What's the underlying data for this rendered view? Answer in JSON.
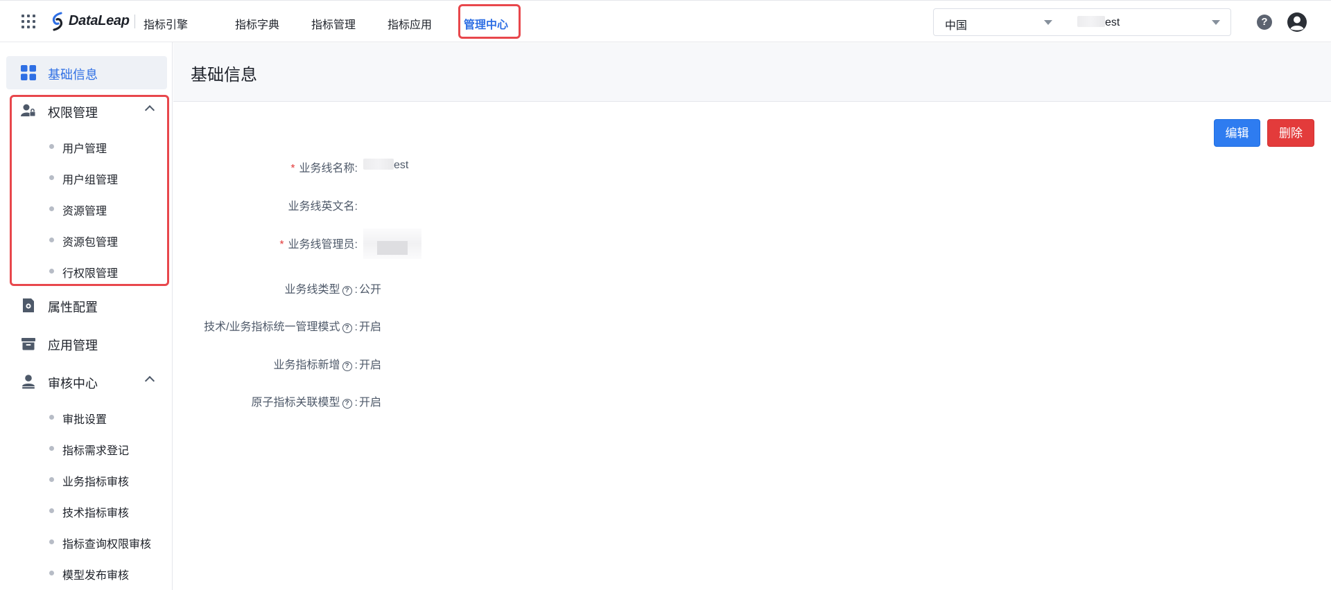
{
  "topbar": {
    "brand": "DataLeap",
    "product": "指标引擎",
    "nav": [
      "指标字典",
      "指标管理",
      "指标应用",
      "管理中心"
    ],
    "region_select": "中国",
    "business_line_select": "est"
  },
  "sidebar": {
    "basic_info": "基础信息",
    "permission": {
      "label": "权限管理",
      "items": [
        "用户管理",
        "用户组管理",
        "资源管理",
        "资源包管理",
        "行权限管理"
      ]
    },
    "attribute_config": "属性配置",
    "app_management": "应用管理",
    "review_center": {
      "label": "审核中心",
      "items": [
        "审批设置",
        "指标需求登记",
        "业务指标审核",
        "技术指标审核",
        "指标查询权限审核",
        "模型发布审核"
      ]
    }
  },
  "main": {
    "title": "基础信息",
    "edit_button": "编辑",
    "delete_button": "删除",
    "fields": {
      "name_label": "业务线名称:",
      "name_value": "est",
      "english_name_label": "业务线英文名:",
      "admin_label": "业务线管理员:",
      "type_label": "业务线类型",
      "type_value": "公开",
      "unified_mode_label": "技术/业务指标统一管理模式",
      "unified_mode_value": "开启",
      "biz_add_label": "业务指标新增",
      "biz_add_value": "开启",
      "atomic_model_label": "原子指标关联模型",
      "atomic_model_value": "开启",
      "colon": ":",
      "required_mark": "*",
      "help_mark": "?"
    }
  },
  "colors": {
    "accent": "#2f6fe4",
    "danger": "#e33b3b",
    "highlight_border": "#e8474c"
  }
}
